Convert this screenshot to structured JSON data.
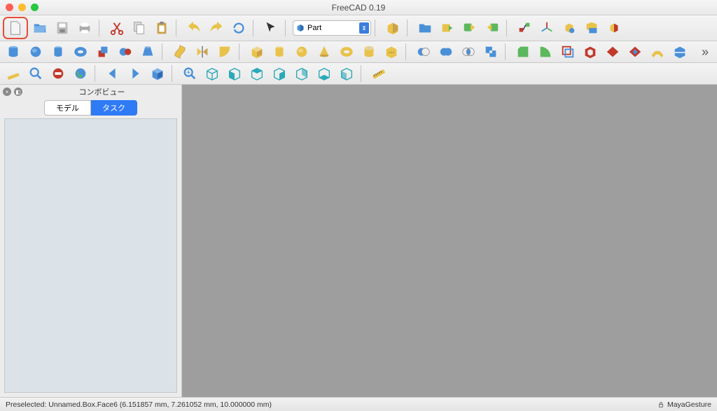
{
  "app": {
    "title": "FreeCAD 0.19"
  },
  "workbench": {
    "selected": "Part"
  },
  "sidepanel": {
    "title": "コンボビュー",
    "tabs": {
      "model": "モデル",
      "task": "タスク",
      "active": "task"
    }
  },
  "status": {
    "preselected": "Preselected: Unnamed.Box.Face6 (6.151857 mm, 7.261052 mm, 10.000000 mm)",
    "nav_style": "MayaGesture"
  },
  "icons": {
    "row1": [
      "new-doc",
      "open",
      "save",
      "print",
      "cut",
      "copy",
      "paste",
      "undo",
      "redo",
      "refresh",
      "cursor",
      "workbench-select",
      "box-yellow",
      "folder",
      "export",
      "link-export",
      "link-import",
      "transform",
      "axis-cross",
      "placement",
      "clip",
      "section"
    ],
    "row2": [
      "cylinder-blue",
      "sphere",
      "cyl",
      "torus",
      "extrude",
      "revolve",
      "loft",
      "sweep",
      "mirror",
      "fillet",
      "box",
      "cyl2",
      "sphere2",
      "cone",
      "torus2",
      "prism",
      "wedge",
      "helix",
      "spiral",
      "circle",
      "ellipse",
      "point",
      "line",
      "regpoly",
      "sketch",
      "pad",
      "pocket",
      "revolve2",
      "groove",
      "extrude2",
      "overflow"
    ],
    "row3": [
      "ruler",
      "zoom",
      "no-entry",
      "earth",
      "arrow-left",
      "arrow-right",
      "cube-view",
      "zoom-all",
      "iso",
      "front",
      "top",
      "right",
      "back",
      "bottom",
      "left-view",
      "measure"
    ]
  }
}
